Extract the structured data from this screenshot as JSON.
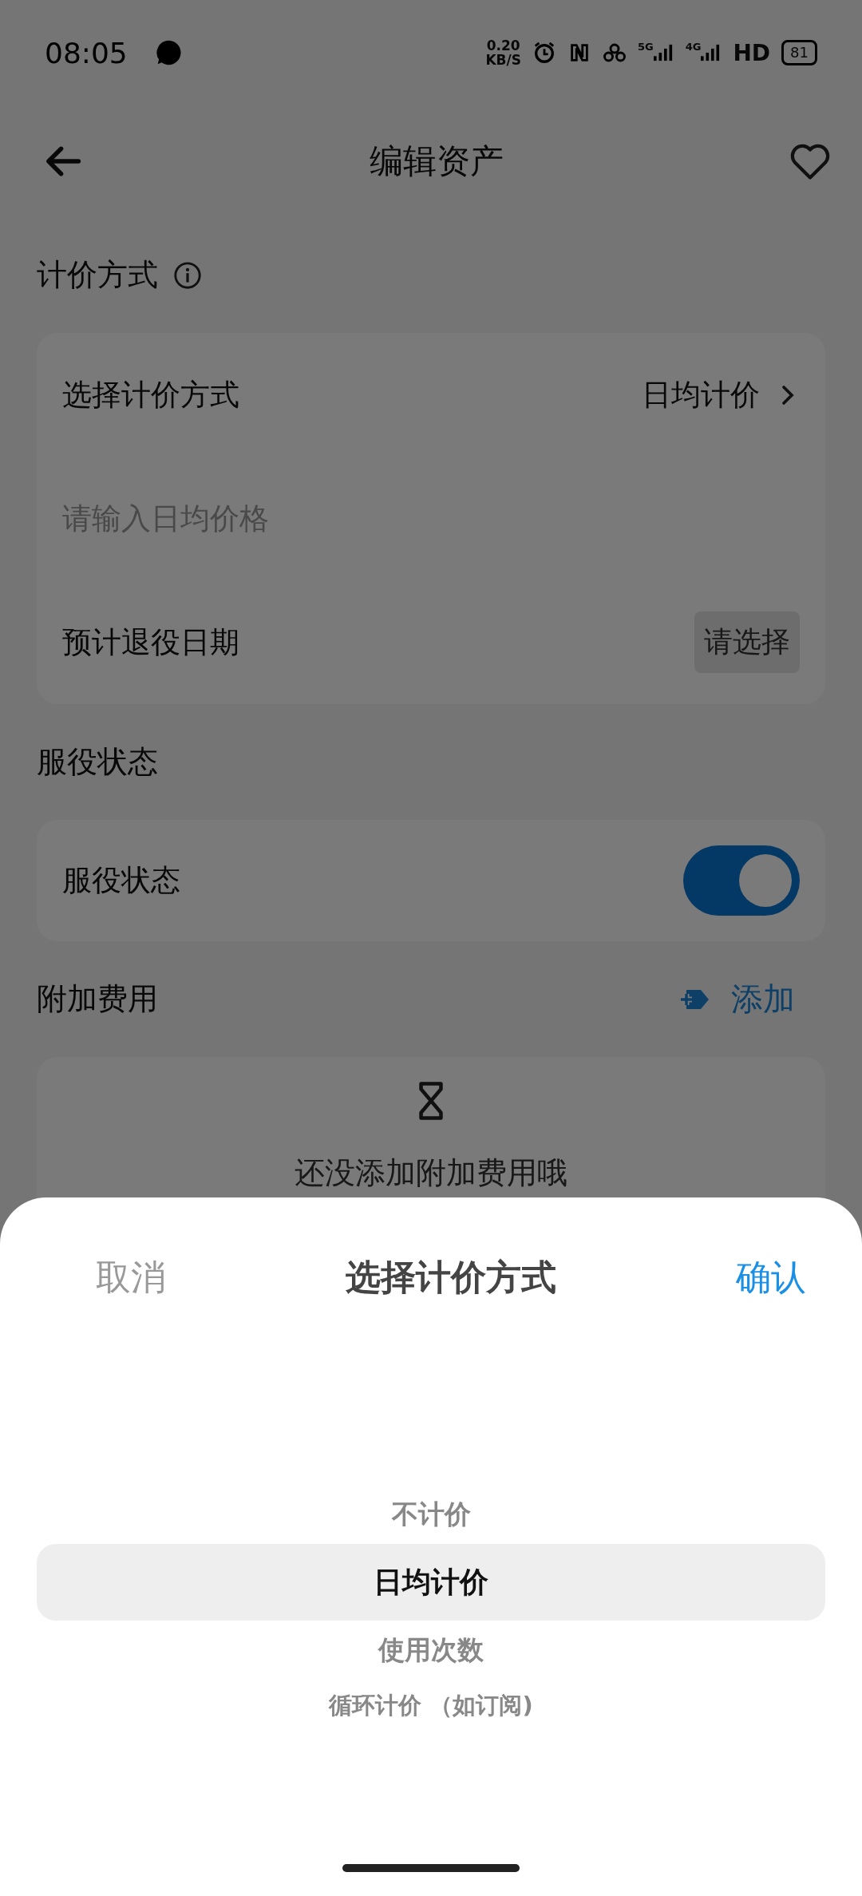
{
  "status_bar": {
    "time": "08:05",
    "net_speed": "0.20",
    "net_unit": "KB/S",
    "sim1": "5G",
    "sim2": "4G",
    "hd": "HD",
    "battery": "81"
  },
  "header": {
    "title": "编辑资产",
    "favorite": false
  },
  "pricing": {
    "label": "计价方式",
    "rows": [
      {
        "kind": "select",
        "label": "选择计价方式",
        "value": "日均计价"
      },
      {
        "kind": "input",
        "placeholder": "请输入日均价格"
      },
      {
        "kind": "date",
        "label": "预计退役日期",
        "button": "请选择"
      }
    ]
  },
  "service": {
    "label": "服役状态",
    "row_label": "服役状态",
    "on": true
  },
  "extra_fees": {
    "label": "附加费用",
    "add": "添加",
    "empty": "还没添加附加费用哦"
  },
  "sheet": {
    "cancel": "取消",
    "title": "选择计价方式",
    "confirm": "确认",
    "options": [
      {
        "label": "不计价",
        "selected": false
      },
      {
        "label": "日均计价",
        "selected": true
      },
      {
        "label": "使用次数",
        "selected": false
      },
      {
        "label": "循环计价 （如订阅)",
        "selected": false
      }
    ]
  }
}
